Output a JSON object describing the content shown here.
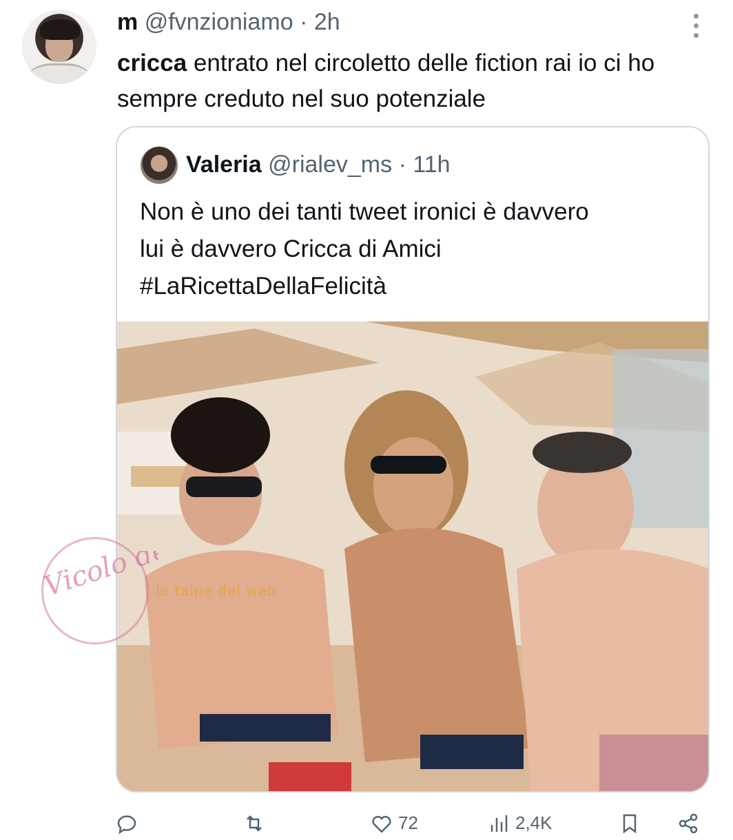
{
  "tweet": {
    "author_name": "m",
    "handle": "@fvnzioniamo",
    "separator": "·",
    "time": "2h",
    "mention": "cricca",
    "text_rest": " entrato nel circoletto delle fiction rai io ci ho sempre creduto nel suo potenziale"
  },
  "quoted": {
    "author_name": "Valeria",
    "handle": "@rialev_ms",
    "separator": "·",
    "time": "11h",
    "line1": "Non è uno dei tanti tweet ironici è davvero",
    "line2": "lui è davvero Cricca di Amici",
    "line3": "#LaRicettaDellaFelicità"
  },
  "watermark": {
    "logo_text": "Vicolo delle News",
    "banner_text": "le talpe del web"
  },
  "actions": {
    "likes": "72",
    "views": "2,4K"
  },
  "icons": [
    "more-vertical-icon",
    "reply-icon",
    "retweet-icon",
    "like-icon",
    "views-icon",
    "bookmark-icon",
    "share-icon"
  ]
}
